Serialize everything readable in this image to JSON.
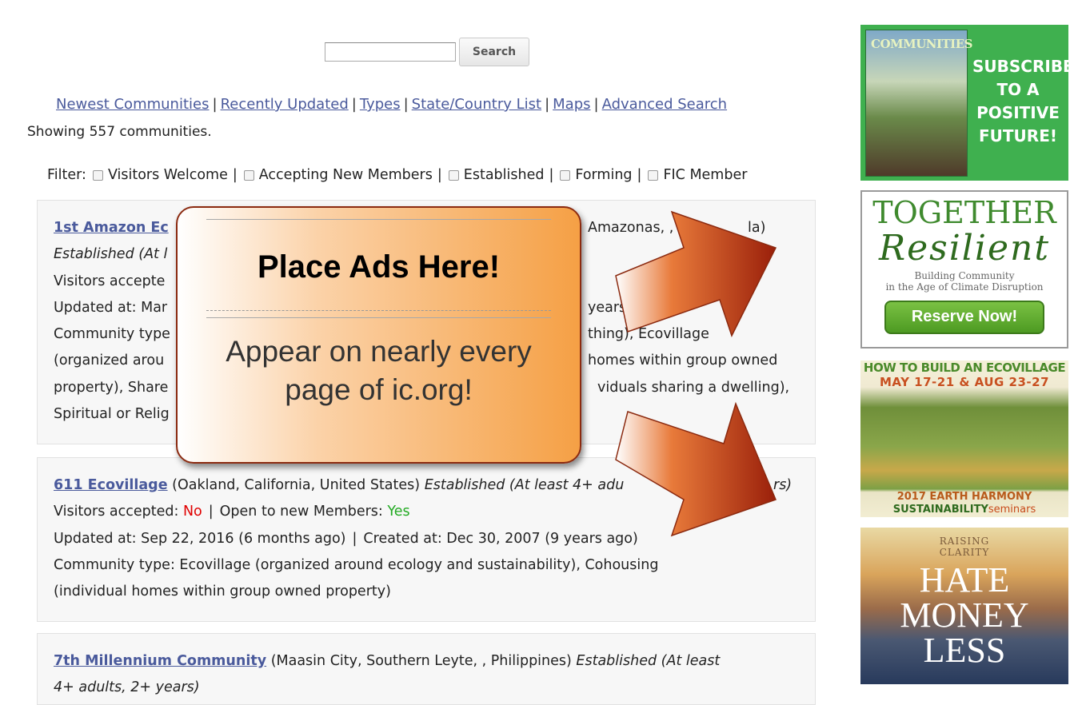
{
  "search": {
    "button_label": "Search",
    "value": ""
  },
  "nav": {
    "links": [
      "Newest Communities",
      "Recently Updated",
      "Types",
      "State/Country List",
      "Maps",
      "Advanced Search"
    ]
  },
  "count_text": "Showing 557 communities.",
  "filters": {
    "label": "Filter:",
    "options": [
      "Visitors Welcome",
      "Accepting New Members",
      "Established",
      "Forming",
      "FIC Member"
    ]
  },
  "communities": [
    {
      "name_visible": "1st Amazon Ec",
      "location_visible": "Amazonas, , V",
      "location_end": "la)",
      "established_visible": "Established (At l",
      "visitors_visible": "Visitors accepte",
      "updated_visible": "Updated at: Mar",
      "updated_end": "years ago)",
      "type_visible": "Community type",
      "type_end": "thing), Ecovillage",
      "type2_visible": "(organized arou",
      "type2_end": "homes within group owned",
      "type3_visible": "property), Share",
      "type3_end": "viduals sharing a dwelling),",
      "type4_visible": "Spiritual or Relig"
    },
    {
      "name": "611 Ecovillage",
      "location": "(Oakland, California, United States)",
      "established": "Established (At least 4+ adu",
      "established_end": "rs)",
      "visitors_label": "Visitors accepted:",
      "visitors_value": "No",
      "members_label": "Open to new Members:",
      "members_value": "Yes",
      "updated": "Updated at: Sep 22, 2016 (6 months ago)",
      "created": "Created at: Dec 30, 2007 (9 years ago)",
      "type_line1": "Community type: Ecovillage (organized around ecology and sustainability), Cohousing",
      "type_line2": "(individual homes within group owned property)"
    },
    {
      "name": "7th Millennium Community",
      "location": "(Maasin City, Southern Leyte, , Philippines)",
      "established": "Established (At least",
      "established2": "4+ adults, 2+ years)"
    }
  ],
  "ad_overlay": {
    "title": "Place Ads Here!",
    "subtitle": "Appear on nearly every page of ic.org!"
  },
  "sidebar_ads": {
    "communities": {
      "magazine_title": "COMMUNITIES",
      "cta": "SUBSCRIBE TO A POSITIVE FUTURE!"
    },
    "together": {
      "title": "TOGETHER",
      "script": "Resilient",
      "tag1": "Building Community",
      "tag2": "in the Age of Climate Disruption",
      "button": "Reserve Now!"
    },
    "ecovillage": {
      "head1": "HOW TO BUILD AN ECOVILLAGE",
      "head2": "MAY 17-21 & AUG 23-27",
      "foot1": "2017 EARTH HARMONY",
      "foot2": "SUSTAINABILITY",
      "foot2b": "seminars"
    },
    "hate": {
      "top1": "RAISING",
      "top2": "CLARITY",
      "w1": "HATE",
      "w2": "MONEY",
      "w3": "LESS"
    }
  },
  "colors": {
    "link": "#4a5a9c",
    "no": "#e00000",
    "yes": "#22aa22",
    "arrow": "#c84a16",
    "ad_green": "#3fb04f"
  }
}
